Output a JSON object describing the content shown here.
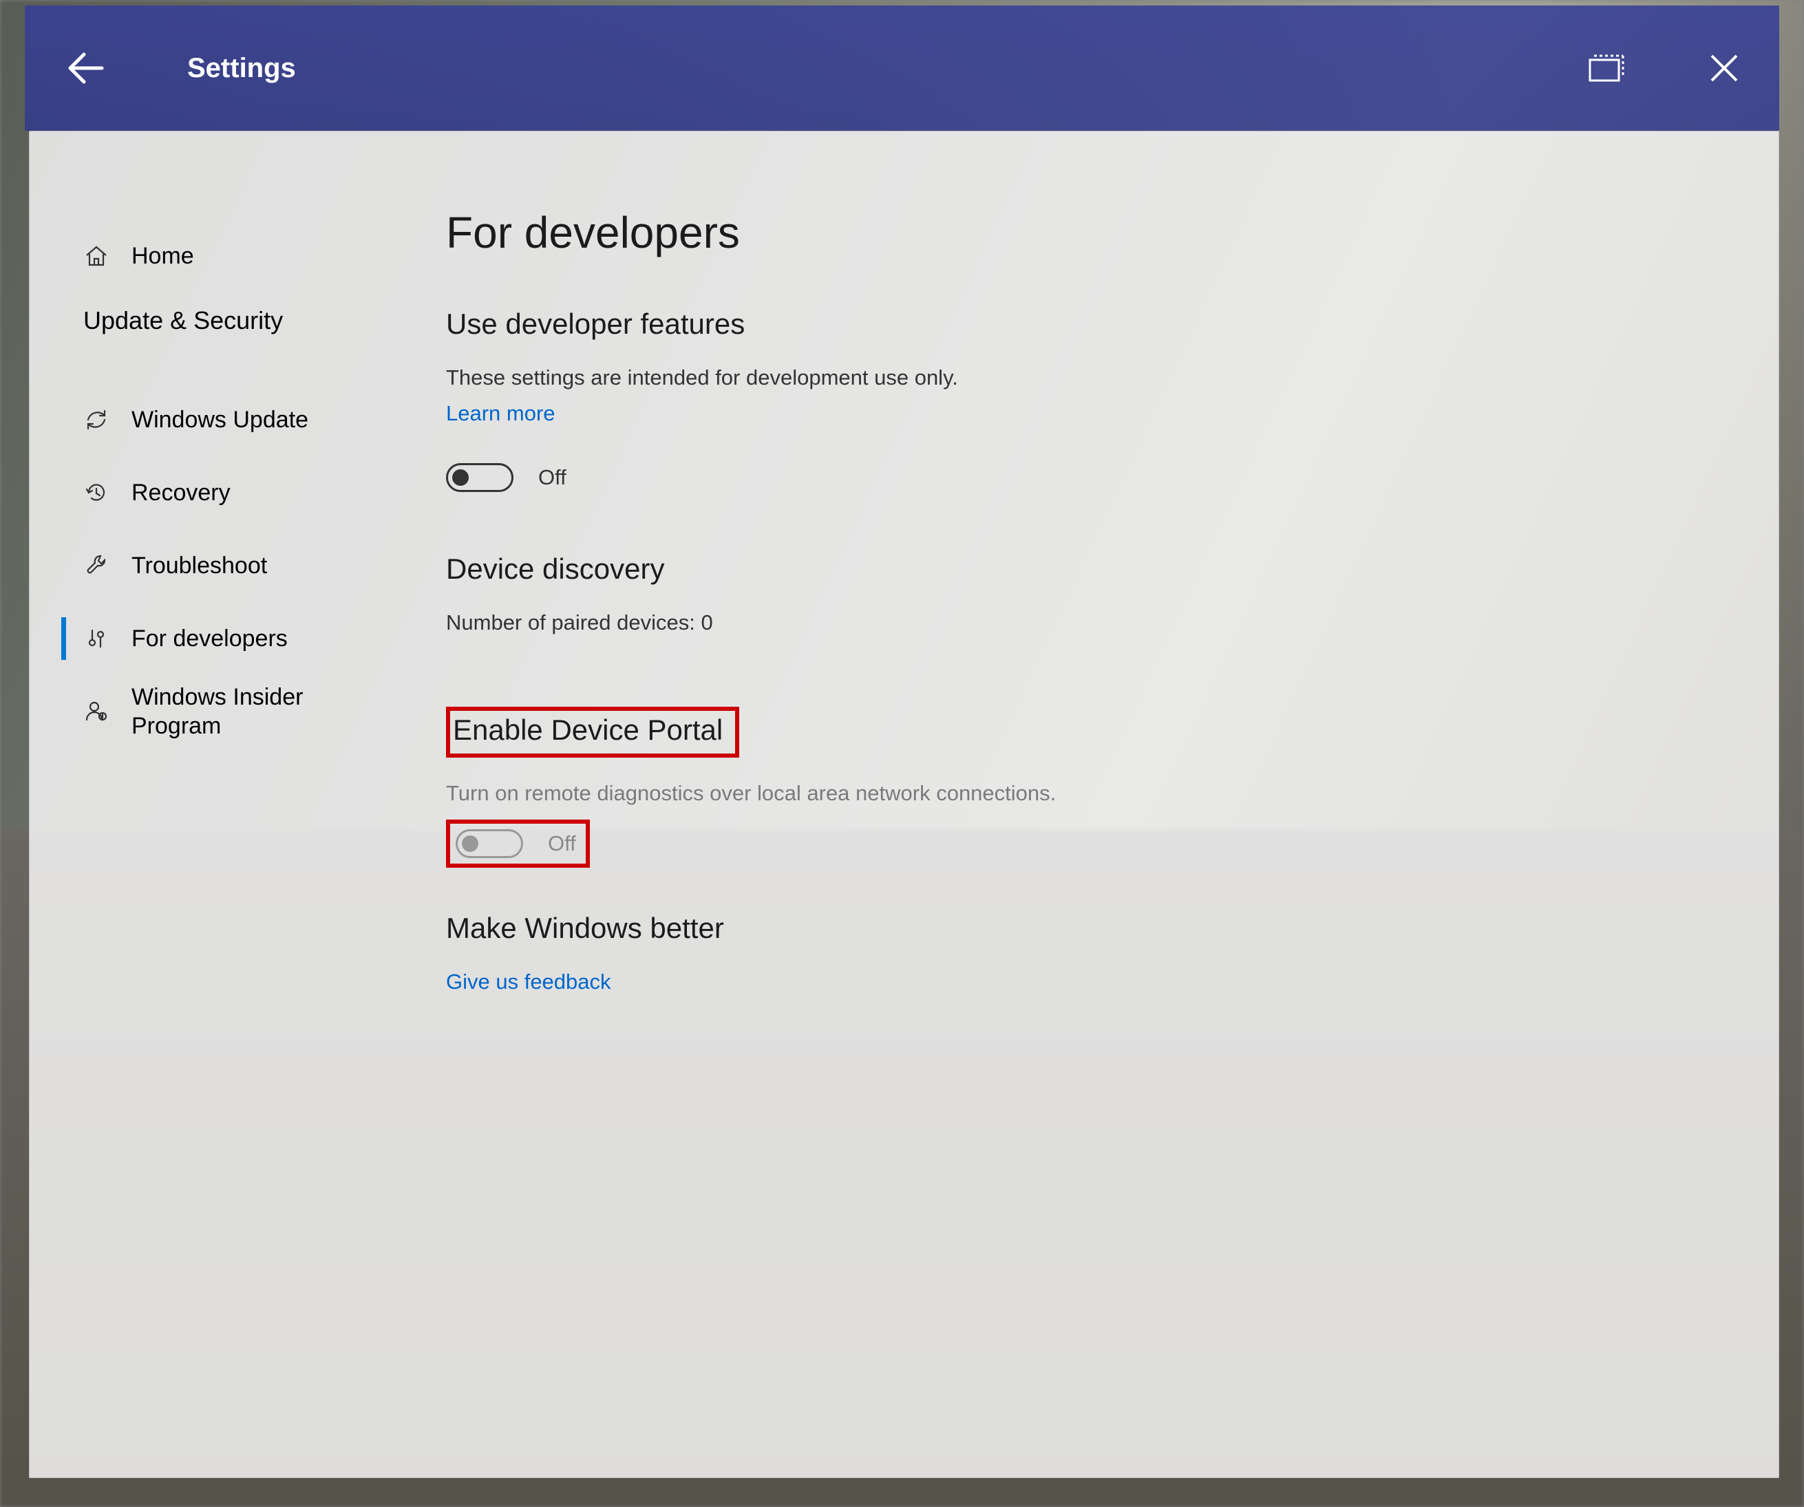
{
  "titlebar": {
    "title": "Settings"
  },
  "sidebar": {
    "home": "Home",
    "category": "Update & Security",
    "items": [
      {
        "label": "Windows Update"
      },
      {
        "label": "Recovery"
      },
      {
        "label": "Troubleshoot"
      },
      {
        "label": "For developers"
      },
      {
        "label": "Windows Insider Program"
      }
    ]
  },
  "main": {
    "page_title": "For developers",
    "s1_heading": "Use developer features",
    "s1_desc": "These settings are intended for development use only.",
    "s1_link": "Learn more",
    "s1_toggle": "Off",
    "s2_heading": "Device discovery",
    "s2_desc": "Number of paired devices: 0",
    "s3_heading": "Enable Device Portal",
    "s3_desc": "Turn on remote diagnostics over local area network connections.",
    "s3_toggle": "Off",
    "s4_heading": "Make Windows better",
    "s4_link": "Give us feedback"
  }
}
